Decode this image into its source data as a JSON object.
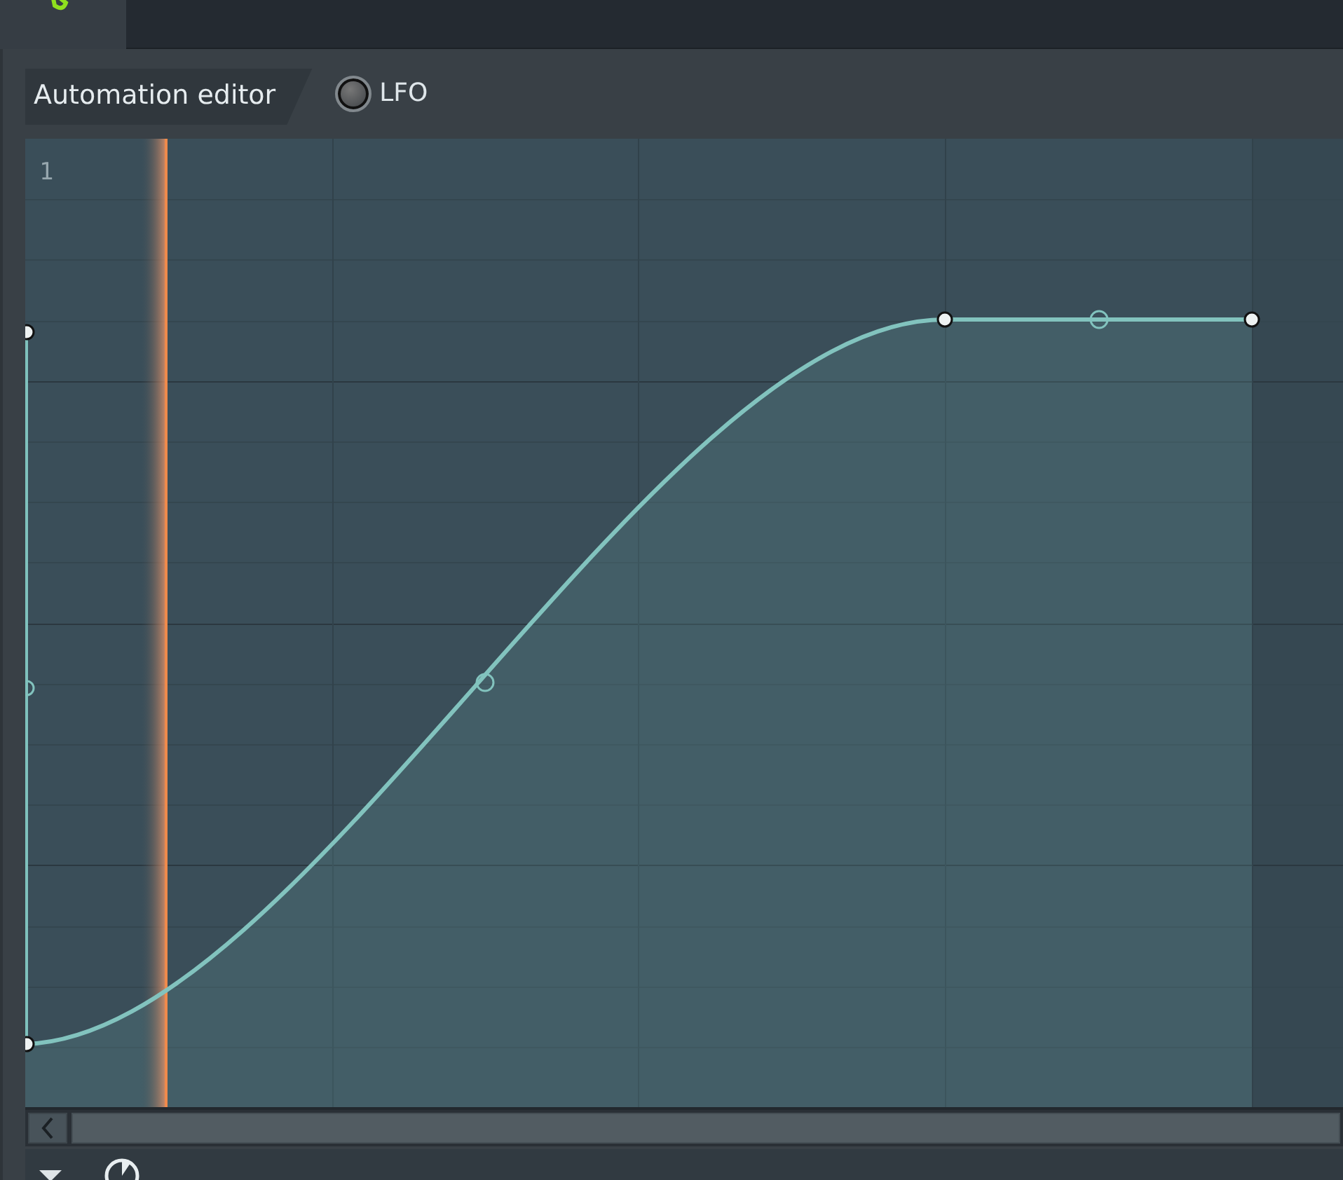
{
  "editor_tab": {
    "label": "Automation editor"
  },
  "lfo": {
    "label": "LFO",
    "selected": false
  },
  "grid": {
    "bar_label": "1"
  }
}
